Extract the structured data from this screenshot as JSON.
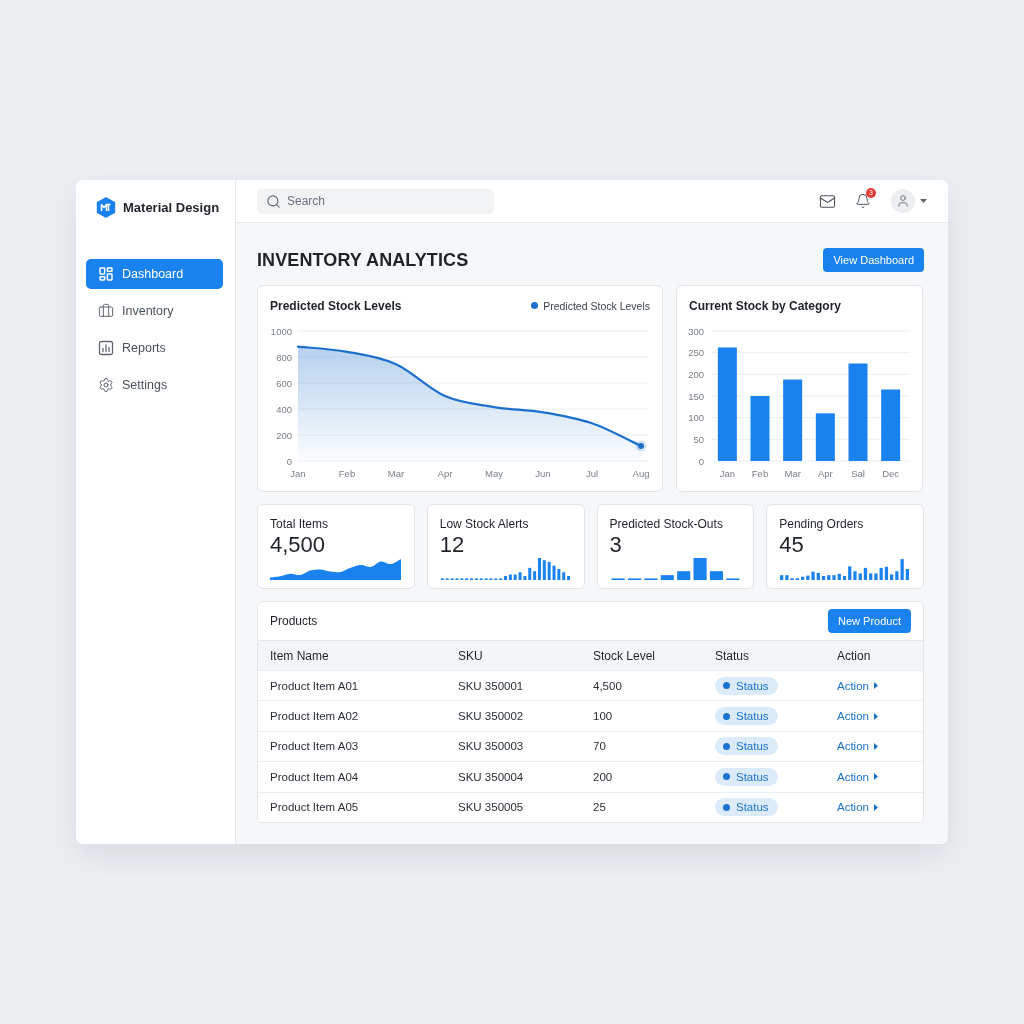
{
  "window": {
    "brand": "Material Design"
  },
  "sidebar": {
    "items": [
      {
        "label": "Dashboard",
        "selected": true
      },
      {
        "label": "Inventory",
        "selected": false
      },
      {
        "label": "Reports",
        "selected": false
      },
      {
        "label": "Settings",
        "selected": false
      }
    ]
  },
  "top_bar": {
    "search": {
      "placeholder": "Search"
    },
    "notification_badge": "3"
  },
  "header": {
    "title": "INVENTORY ANALYTICS",
    "button": "View Dashboard"
  },
  "line_chart_card": {
    "chart_data": {
      "type": "area",
      "title": "Predicted Stock Levels",
      "categories": [
        "Jan",
        "Feb",
        "Mar",
        "Apr",
        "May",
        "Jun",
        "Jul",
        "Aug"
      ],
      "series": [
        {
          "name": "Predicted Stock Levels",
          "color": "#1c70cc",
          "values": [
            880,
            840,
            745,
            500,
            415,
            375,
            290,
            115
          ]
        }
      ],
      "ylim": [
        0,
        1000
      ],
      "yticks": [
        0,
        200,
        400,
        600,
        800,
        1000
      ],
      "grid": true
    }
  },
  "bar_chart_card": {
    "chart_data": {
      "type": "bar",
      "title": "Current Stock by Category",
      "categories": [
        "Jan",
        "Feb",
        "Mar",
        "Apr",
        "Sal",
        "Dec"
      ],
      "values": [
        262,
        150,
        188,
        110,
        225,
        165
      ],
      "ylim": [
        0,
        300
      ],
      "yticks": [
        0,
        50,
        100,
        150,
        200,
        250,
        300
      ],
      "grid": true
    }
  },
  "kpi_cards": [
    {
      "label": "Total Items",
      "value": "4,500",
      "kind": "area"
    },
    {
      "label": "Low Stock Alerts",
      "value": "12",
      "kind": "bars"
    },
    {
      "label": "Predicted Stock-Outs",
      "value": "3",
      "kind": "bars"
    },
    {
      "label": "Pending Orders",
      "value": "45",
      "kind": "bars"
    }
  ],
  "products": {
    "title": "Products",
    "button": "New Product",
    "columns": [
      "Item Name",
      "SKU",
      "Stock Level",
      "Status",
      "Action"
    ],
    "rows": [
      {
        "item_name": "Product Item A01",
        "sku": "SKU 350001",
        "stock_level": "4,500",
        "status": "Status",
        "action": "Action"
      },
      {
        "item_name": "Product Item A02",
        "sku": "SKU 350002",
        "stock_level": "100",
        "status": "Status",
        "action": "Action"
      },
      {
        "item_name": "Product Item A03",
        "sku": "SKU 350003",
        "stock_level": "70",
        "status": "Status",
        "action": "Action"
      },
      {
        "item_name": "Product Item A04",
        "sku": "SKU 350004",
        "stock_level": "200",
        "status": "Status",
        "action": "Action"
      },
      {
        "item_name": "Product Item A05",
        "sku": "SKU 350005",
        "stock_level": "25",
        "status": "Status",
        "action": "Action"
      }
    ]
  }
}
